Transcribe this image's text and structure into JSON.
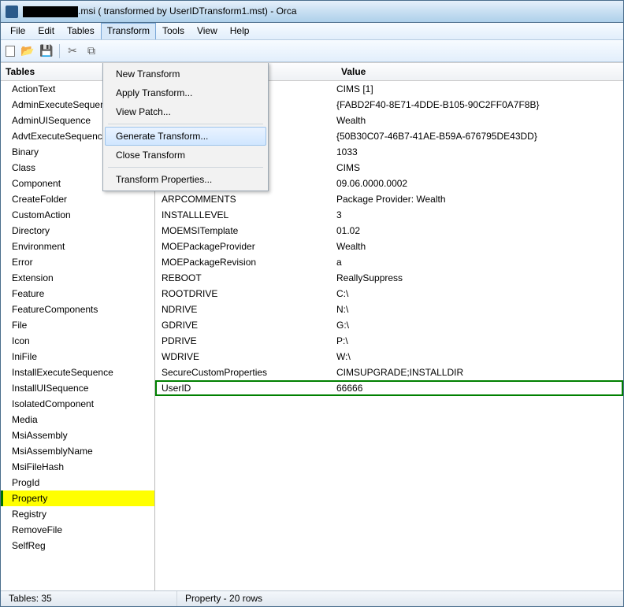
{
  "title_suffix": ".msi ( transformed by UserIDTransform1.mst) - Orca",
  "menubar": [
    "File",
    "Edit",
    "Tables",
    "Transform",
    "Tools",
    "View",
    "Help"
  ],
  "menubar_open_index": 3,
  "dropdown": {
    "items": [
      {
        "label": "New Transform",
        "sep": false
      },
      {
        "label": "Apply Transform...",
        "sep": false
      },
      {
        "label": "View Patch...",
        "sep": true
      },
      {
        "label": "Generate Transform...",
        "sep": false,
        "hover": true
      },
      {
        "label": "Close Transform",
        "sep": true
      },
      {
        "label": "Transform Properties...",
        "sep": false
      }
    ]
  },
  "left_header": "Tables",
  "tables": [
    "ActionText",
    "AdminExecuteSequence",
    "AdminUISequence",
    "AdvtExecuteSequence",
    "Binary",
    "Class",
    "Component",
    "CreateFolder",
    "CustomAction",
    "Directory",
    "Environment",
    "Error",
    "Extension",
    "Feature",
    "FeatureComponents",
    "File",
    "Icon",
    "IniFile",
    "InstallExecuteSequence",
    "InstallUISequence",
    "IsolatedComponent",
    "Media",
    "MsiAssembly",
    "MsiAssemblyName",
    "MsiFileHash",
    "ProgId",
    "Property",
    "Registry",
    "RemoveFile",
    "SelfReg"
  ],
  "selected_table_index": 26,
  "right_header_value": "Value",
  "property_rows": [
    {
      "name": "",
      "value": "CIMS [1]"
    },
    {
      "name": "",
      "value": "{FABD2F40-8E71-4DDE-B105-90C2FF0A7F8B}"
    },
    {
      "name": "",
      "value": "Wealth"
    },
    {
      "name": "",
      "value": "{50B30C07-46B7-41AE-B59A-676795DE43DD}"
    },
    {
      "name": "ProductLanguage",
      "value": "1033"
    },
    {
      "name": "ProductName",
      "value": "CIMS"
    },
    {
      "name": "ProductVersion",
      "value": "09.06.0000.0002"
    },
    {
      "name": "ARPCOMMENTS",
      "value": "Package Provider: Wealth"
    },
    {
      "name": "INSTALLLEVEL",
      "value": "3"
    },
    {
      "name": "MOEMSITemplate",
      "value": "01.02"
    },
    {
      "name": "MOEPackageProvider",
      "value": "Wealth"
    },
    {
      "name": "MOEPackageRevision",
      "value": "a"
    },
    {
      "name": "REBOOT",
      "value": "ReallySuppress"
    },
    {
      "name": "ROOTDRIVE",
      "value": "C:\\"
    },
    {
      "name": "NDRIVE",
      "value": "N:\\"
    },
    {
      "name": "GDRIVE",
      "value": "G:\\"
    },
    {
      "name": "PDRIVE",
      "value": "P:\\"
    },
    {
      "name": "WDRIVE",
      "value": "W:\\"
    },
    {
      "name": "SecureCustomProperties",
      "value": "CIMSUPGRADE;INSTALLDIR"
    },
    {
      "name": "UserID",
      "value": "66666",
      "highlight": true
    }
  ],
  "status_left": "Tables: 35",
  "status_right": "Property - 20 rows"
}
